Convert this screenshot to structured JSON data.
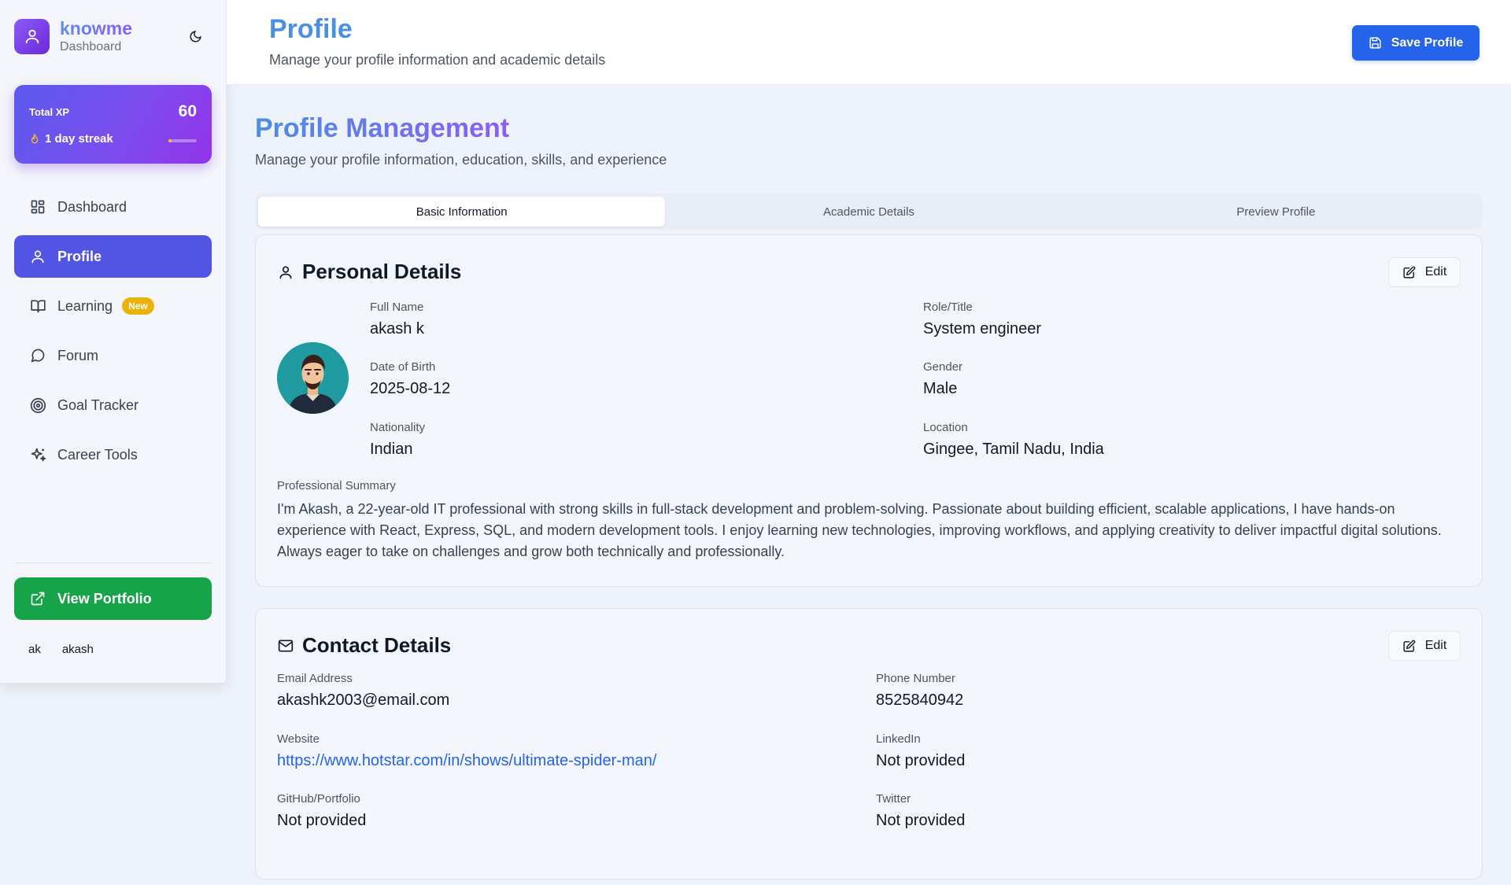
{
  "brand": {
    "name": "knowme",
    "subtitle": "Dashboard"
  },
  "xp": {
    "label": "Total XP",
    "value": "60",
    "streak": "1 day streak",
    "progress_fraction": 0.1
  },
  "nav": {
    "items": [
      {
        "label": "Dashboard",
        "icon": "dashboard-grid-icon"
      },
      {
        "label": "Profile",
        "icon": "user-icon",
        "active": true
      },
      {
        "label": "Learning",
        "icon": "book-icon",
        "badge": "New"
      },
      {
        "label": "Forum",
        "icon": "chat-bubble-icon"
      },
      {
        "label": "Goal Tracker",
        "icon": "target-icon"
      },
      {
        "label": "Career Tools",
        "icon": "sparkle-icon"
      }
    ]
  },
  "portfolio_button": "View Portfolio",
  "user": {
    "initials": "ak",
    "name": "akash"
  },
  "header": {
    "title": "Profile",
    "subtitle": "Manage your profile information and academic details",
    "save_label": "Save Profile"
  },
  "page": {
    "title": "Profile Management",
    "subtitle": "Manage your profile information, education, skills, and experience"
  },
  "tabs": [
    {
      "label": "Basic Information",
      "active": true
    },
    {
      "label": "Academic Details"
    },
    {
      "label": "Preview Profile"
    }
  ],
  "personal": {
    "title": "Personal Details",
    "edit_label": "Edit",
    "fields": {
      "full_name": {
        "label": "Full Name",
        "value": "akash k"
      },
      "role": {
        "label": "Role/Title",
        "value": "System engineer"
      },
      "dob": {
        "label": "Date of Birth",
        "value": "2025-08-12"
      },
      "gender": {
        "label": "Gender",
        "value": "Male"
      },
      "nationality": {
        "label": "Nationality",
        "value": "Indian"
      },
      "location": {
        "label": "Location",
        "value": "Gingee, Tamil Nadu, India"
      }
    },
    "summary_label": "Professional Summary",
    "summary": "I'm Akash, a 22-year-old IT professional with strong skills in full-stack development and problem-solving. Passionate about building efficient, scalable applications, I have hands-on experience with React, Express, SQL, and modern development tools. I enjoy learning new technologies, improving workflows, and applying creativity to deliver impactful digital solutions. Always eager to take on challenges and grow both technically and professionally."
  },
  "contact": {
    "title": "Contact Details",
    "edit_label": "Edit",
    "fields": {
      "email": {
        "label": "Email Address",
        "value": "akashk2003@email.com"
      },
      "phone": {
        "label": "Phone Number",
        "value": "8525840942"
      },
      "website": {
        "label": "Website",
        "value": "https://www.hotstar.com/in/shows/ultimate-spider-man/"
      },
      "linkedin": {
        "label": "LinkedIn",
        "value": "Not provided"
      },
      "github": {
        "label": "GitHub/Portfolio",
        "value": "Not provided"
      },
      "twitter": {
        "label": "Twitter",
        "value": "Not provided"
      }
    }
  },
  "colors": {
    "accent_blue": "#2563eb",
    "nav_active": "#5255e4",
    "portfolio_green": "#16a34a",
    "badge_yellow": "#eab308",
    "title_blue": "#4a8fe2"
  }
}
